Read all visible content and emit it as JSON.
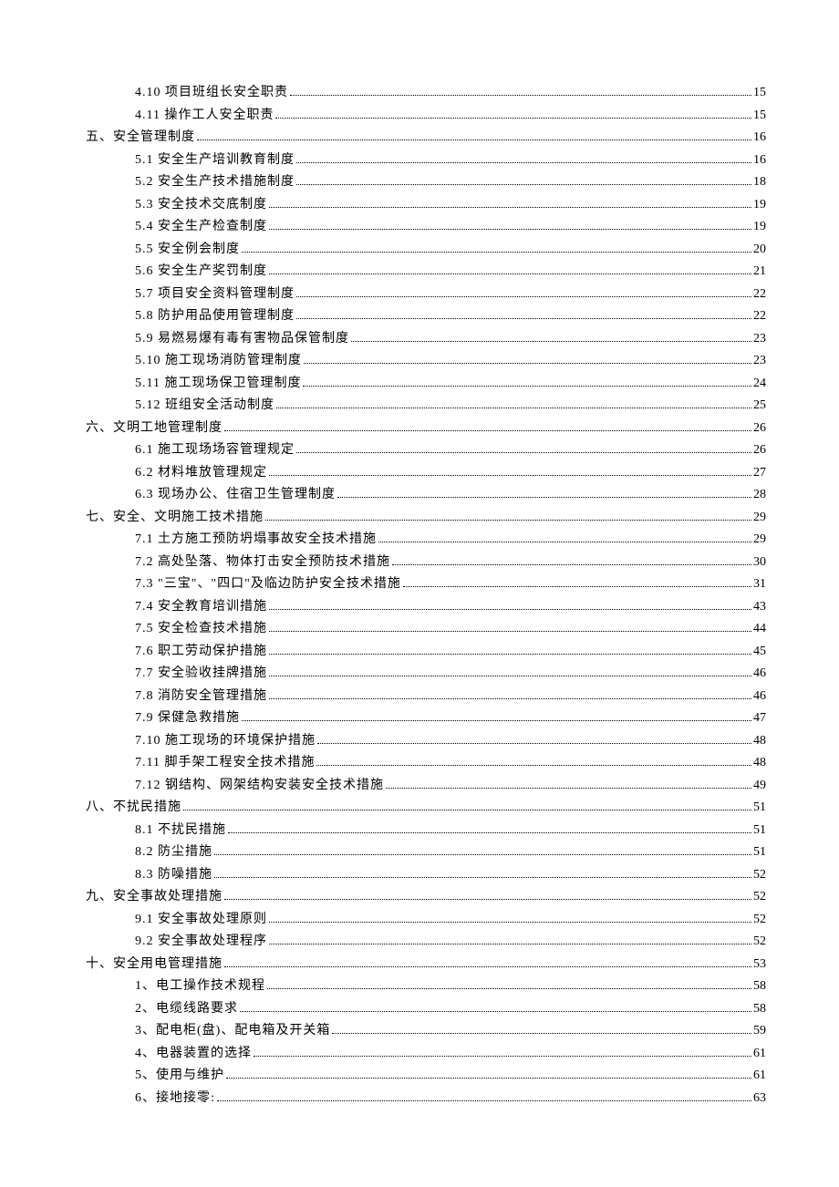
{
  "toc": [
    {
      "level": 1,
      "label": "4.10 项目班组长安全职责",
      "page": "15"
    },
    {
      "level": 1,
      "label": "4.11 操作工人安全职责",
      "page": "15"
    },
    {
      "level": 0,
      "label": "五、安全管理制度",
      "page": "16"
    },
    {
      "level": 1,
      "label": "5.1 安全生产培训教育制度",
      "page": "16"
    },
    {
      "level": 1,
      "label": "5.2 安全生产技术措施制度",
      "page": "18"
    },
    {
      "level": 1,
      "label": "5.3 安全技术交底制度",
      "page": "19"
    },
    {
      "level": 1,
      "label": "5.4 安全生产检查制度",
      "page": "19"
    },
    {
      "level": 1,
      "label": "5.5 安全例会制度",
      "page": "20"
    },
    {
      "level": 1,
      "label": "5.6 安全生产奖罚制度",
      "page": "21"
    },
    {
      "level": 1,
      "label": "5.7 项目安全资料管理制度",
      "page": "22"
    },
    {
      "level": 1,
      "label": "5.8 防护用品使用管理制度",
      "page": "22"
    },
    {
      "level": 1,
      "label": "5.9 易燃易爆有毒有害物品保管制度",
      "page": "23"
    },
    {
      "level": 1,
      "label": "5.10 施工现场消防管理制度",
      "page": "23"
    },
    {
      "level": 1,
      "label": "5.11 施工现场保卫管理制度",
      "page": "24"
    },
    {
      "level": 1,
      "label": "5.12 班组安全活动制度",
      "page": "25"
    },
    {
      "level": 0,
      "label": "六、文明工地管理制度",
      "page": "26"
    },
    {
      "level": 1,
      "label": "6.1 施工现场场容管理规定",
      "page": "26"
    },
    {
      "level": 1,
      "label": "6.2 材料堆放管理规定",
      "page": "27"
    },
    {
      "level": 1,
      "label": "6.3 现场办公、住宿卫生管理制度",
      "page": "28"
    },
    {
      "level": 0,
      "label": "七、安全、文明施工技术措施",
      "page": "29"
    },
    {
      "level": 1,
      "label": "7.1 土方施工预防坍塌事故安全技术措施",
      "page": "29"
    },
    {
      "level": 1,
      "label": "7.2 高处坠落、物体打击安全预防技术措施",
      "page": "30"
    },
    {
      "level": 1,
      "label": "7.3 \"三宝\"、\"四口\"及临边防护安全技术措施",
      "page": "31"
    },
    {
      "level": 1,
      "label": "7.4 安全教育培训措施",
      "page": "43"
    },
    {
      "level": 1,
      "label": "7.5 安全检查技术措施",
      "page": "44"
    },
    {
      "level": 1,
      "label": "7.6 职工劳动保护措施",
      "page": "45"
    },
    {
      "level": 1,
      "label": "7.7 安全验收挂牌措施",
      "page": "46"
    },
    {
      "level": 1,
      "label": "7.8 消防安全管理措施",
      "page": "46"
    },
    {
      "level": 1,
      "label": "7.9 保健急救措施",
      "page": "47"
    },
    {
      "level": 1,
      "label": "7.10 施工现场的环境保护措施",
      "page": "48"
    },
    {
      "level": 1,
      "label": "7.11 脚手架工程安全技术措施",
      "page": "48"
    },
    {
      "level": 1,
      "label": "7.12 钢结构、网架结构安装安全技术措施",
      "page": "49"
    },
    {
      "level": 0,
      "label": "八、不扰民措施",
      "page": "51"
    },
    {
      "level": 1,
      "label": "8.1 不扰民措施",
      "page": "51"
    },
    {
      "level": 1,
      "label": "8.2 防尘措施",
      "page": "51"
    },
    {
      "level": 1,
      "label": "8.3 防噪措施",
      "page": "52"
    },
    {
      "level": 0,
      "label": "九、安全事故处理措施",
      "page": "52"
    },
    {
      "level": 1,
      "label": "9.1 安全事故处理原则",
      "page": "52"
    },
    {
      "level": 1,
      "label": "9.2 安全事故处理程序",
      "page": "52"
    },
    {
      "level": 0,
      "label": "十、安全用电管理措施",
      "page": "53"
    },
    {
      "level": 1,
      "label": "1、电工操作技术规程",
      "page": "58"
    },
    {
      "level": 1,
      "label": "2、电缆线路要求",
      "page": "58"
    },
    {
      "level": 1,
      "label": "3、配电柜(盘)、配电箱及开关箱",
      "page": "59"
    },
    {
      "level": 1,
      "label": "4、电器装置的选择",
      "page": "61"
    },
    {
      "level": 1,
      "label": "5、使用与维护",
      "page": "61"
    },
    {
      "level": 1,
      "label": "6、接地接零:",
      "page": "63"
    }
  ]
}
